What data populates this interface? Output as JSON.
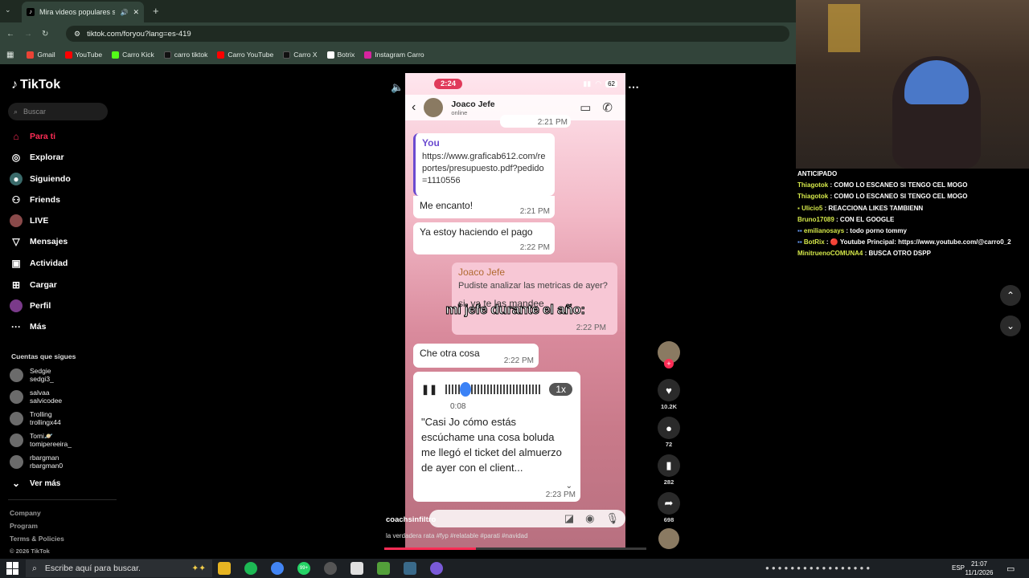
{
  "browser": {
    "tab_title": "Mira videos populares selec",
    "url": "tiktok.com/foryou?lang=es-419",
    "bookmarks": [
      {
        "label": "Gmail",
        "color": "#ea4335"
      },
      {
        "label": "YouTube",
        "color": "#ff0000"
      },
      {
        "label": "Carro Kick",
        "color": "#53fc18"
      },
      {
        "label": "carro tiktok",
        "color": "#000000"
      },
      {
        "label": "Carro YouTube",
        "color": "#ff0000"
      },
      {
        "label": "Carro X",
        "color": "#000000"
      },
      {
        "label": "Botrix",
        "color": "#ffffff"
      },
      {
        "label": "Instagram Carro",
        "color": "#d6249f"
      }
    ]
  },
  "tiktok": {
    "logo": "TikTok",
    "search_placeholder": "Buscar",
    "nav": [
      {
        "label": "Para ti",
        "icon": "home-icon",
        "active": true
      },
      {
        "label": "Explorar",
        "icon": "compass-icon"
      },
      {
        "label": "Siguiendo",
        "icon": "following-icon"
      },
      {
        "label": "Friends",
        "icon": "friends-icon"
      },
      {
        "label": "LIVE",
        "icon": "live-icon"
      },
      {
        "label": "Mensajes",
        "icon": "messages-icon"
      },
      {
        "label": "Actividad",
        "icon": "activity-icon"
      },
      {
        "label": "Cargar",
        "icon": "upload-icon"
      },
      {
        "label": "Perfil",
        "icon": "profile-icon"
      },
      {
        "label": "Más",
        "icon": "more-icon"
      }
    ],
    "following_title": "Cuentas que sigues",
    "following": [
      {
        "name": "Sedgie",
        "handle": "sedgi3_"
      },
      {
        "name": "salvaa",
        "handle": "salvicodee"
      },
      {
        "name": "Trolling",
        "handle": "trollingx44"
      },
      {
        "name": "Tomi🪐",
        "handle": "tomipereeira_"
      },
      {
        "name": "rbargman",
        "handle": "rbargman0"
      }
    ],
    "see_more": "Ver más",
    "footer": [
      "Company",
      "Program",
      "Terms & Policies",
      "© 2026 TikTok"
    ]
  },
  "video": {
    "phone_time": "2:24",
    "battery": "62",
    "contact_name": "Joaco Jefe",
    "contact_status": "online",
    "overlay_text": "mi jefe durante el año:",
    "messages": {
      "top_time": "2:21 PM",
      "you_label": "You",
      "link_text": "https://www.graficab612.com/reportes/presupuesto.pdf?pedido=1110556",
      "m1": "Me encanto!",
      "m1_time": "2:21 PM",
      "m2": "Ya estoy haciendo el pago",
      "m2_time": "2:22 PM",
      "quote_name": "Joaco Jefe",
      "quote_text": "Pudiste analizar las metricas de ayer?",
      "reply": "si, ya te las mandee",
      "reply_time": "2:22 PM",
      "m3": "Che otra cosa",
      "m3_time": "2:22 PM",
      "audio_duration": "0:08",
      "audio_speed": "1x",
      "transcript": "\"Casi Jo cómo estás escúchame una cosa boluda me llegó el ticket del almuerzo de ayer con el client...",
      "transcript_time": "2:23 PM"
    },
    "author": "coachsinfiltro",
    "caption": "la verdadera rata #fyp #relatable #parati #navidad",
    "progress": 0.35
  },
  "actions": {
    "likes": "10.2K",
    "comments": "72",
    "saves": "282",
    "shares": "698"
  },
  "stream_chat": [
    {
      "user": "",
      "text": "ANTICIPADO"
    },
    {
      "user": "Thiagotok",
      "text": ": COMO LO ESCANEO SI TENGO CEL MOGO"
    },
    {
      "user": "Thiagotok",
      "text": ": COMO LO ESCANEO SI TENGO CEL MOGO"
    },
    {
      "user": "Ulicio5",
      "text": ": REACCIONA LIKES TAMBIENN"
    },
    {
      "user": "Bruno17089",
      "text": ": CON EL GOOGLE"
    },
    {
      "user": "emilianosays",
      "text": ": todo porno tommy"
    },
    {
      "user": "BotRix",
      "text": ": 🔴 Youtube Principal: https://www.youtube.com/@carro0_2"
    },
    {
      "user": "MinitruenoCOMUNA4",
      "text": ": BUSCA OTRO DSPP"
    }
  ],
  "taskbar": {
    "search_placeholder": "Escribe aquí para buscar.",
    "lang": "ESP",
    "time": "21:07",
    "date": "11/1/2026",
    "whatsapp_badge": "99+"
  }
}
